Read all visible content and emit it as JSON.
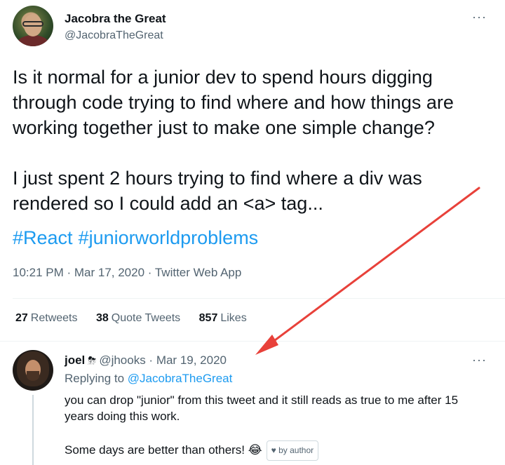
{
  "main_tweet": {
    "author_name": "Jacobra the Great",
    "author_handle": "@JacobraTheGreat",
    "more_label": "···",
    "text_lines": [
      "Is it normal for a junior dev to spend hours digging",
      "through code trying to find where and how things are",
      "working together just to make one simple change?",
      "I just spent 2 hours trying to find where a div was",
      "rendered so I could add an <a> tag..."
    ],
    "hashtags": [
      "#React",
      "#juniorworldproblems"
    ],
    "timestamp": "10:21 PM · Mar 17, 2020 · Twitter Web App",
    "stats": {
      "retweets_count": "27",
      "retweets_label": "Retweets",
      "quotes_count": "38",
      "quotes_label": "Quote Tweets",
      "likes_count": "857",
      "likes_label": "Likes"
    }
  },
  "reply": {
    "author_name": "joel",
    "emoji": "⛈",
    "author_meta": "@jhooks · Mar 19, 2020",
    "more_label": "···",
    "replying_prefix": "Replying to",
    "replying_to": "@JacobraTheGreat",
    "text_line_1": "you can drop \"junior\" from this tweet and it still reads as true to me after 15",
    "text_line_2": "years doing this work.",
    "text_line_3": "Some days are better than others! 😂",
    "badge_icon": "♥",
    "badge_label": "by author"
  },
  "colors": {
    "link": "#1d9bf0",
    "muted": "#536471",
    "annotation_arrow": "#e8413a"
  }
}
